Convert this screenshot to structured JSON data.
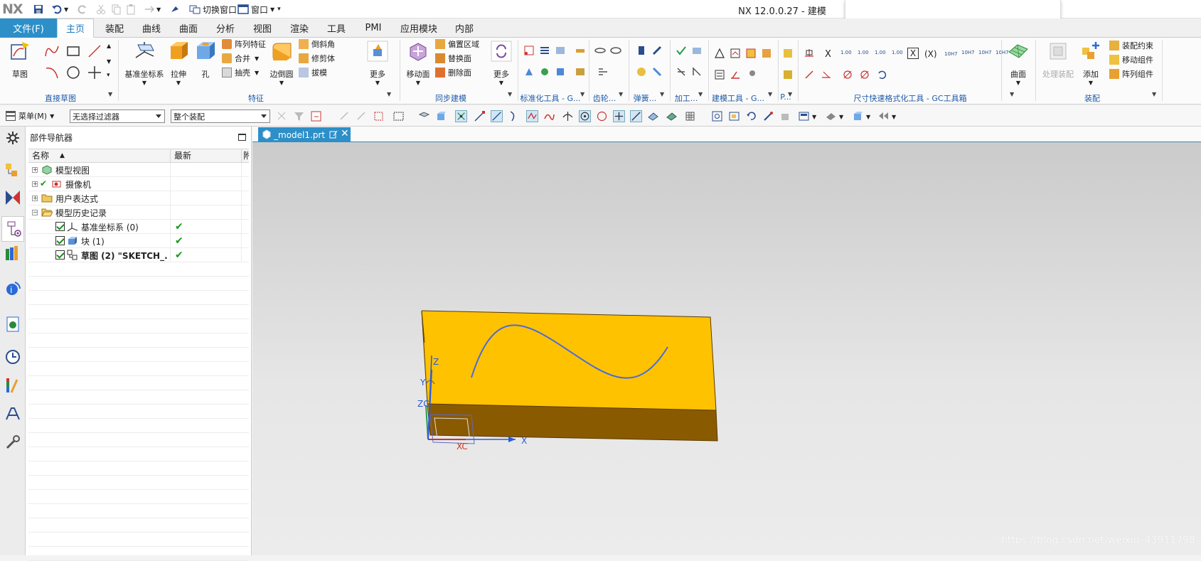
{
  "app": {
    "logo": "NX",
    "title": "NX 12.0.0.27 - 建模"
  },
  "quick_access": {
    "switch_window": "切换窗口",
    "window": "窗口"
  },
  "tabs": {
    "file": "文件(F)",
    "items": [
      "主页",
      "装配",
      "曲线",
      "曲面",
      "分析",
      "视图",
      "渲染",
      "工具",
      "PMI",
      "应用模块",
      "内部"
    ],
    "active": "主页"
  },
  "ribbon": {
    "direct_sketch": {
      "sketch": "草图",
      "label": "直接草图"
    },
    "feature": {
      "datum_csys": "基准坐标系",
      "extrude": "拉伸",
      "hole": "孔",
      "pattern_feature": "阵列特征",
      "unite": "合并",
      "shell": "抽壳",
      "edge_blend": "边倒圆",
      "chamfer": "倒斜角",
      "trim_body": "修剪体",
      "draft": "拔模",
      "more": "更多",
      "label": "特征"
    },
    "sync": {
      "move_face": "移动面",
      "offset_region": "偏置区域",
      "replace_face": "替换面",
      "delete_face": "删除面",
      "more": "更多",
      "label": "同步建模"
    },
    "std_tools": {
      "label": "标准化工具 - G..."
    },
    "gear": {
      "label": "齿轮..."
    },
    "spring": {
      "label": "弹簧..."
    },
    "machining": {
      "label": "加工..."
    },
    "modeling_tools": {
      "label": "建模工具 - G..."
    },
    "p_group": {
      "label": "P..."
    },
    "dim_tools": {
      "label": "尺寸快速格式化工具 - GC工具箱",
      "x": "X",
      "xp": "(X)",
      "v1": "1.00",
      "v2": "1.00",
      "v3": "1.00",
      "v4": "1.00",
      "h1": "10H7",
      "h2": "10H7",
      "h3": "10H7",
      "h4": "10H7"
    },
    "surface": {
      "surface": "曲面",
      "process_assembly": "处理装配",
      "add": "添加"
    },
    "assembly": {
      "constraint": "装配约束",
      "move_component": "移动组件",
      "pattern_component": "阵列组件",
      "label": "装配"
    }
  },
  "toolbar2": {
    "menu": "菜单(M)",
    "filter": "无选择过滤器",
    "scope": "整个装配"
  },
  "navigator": {
    "title": "部件导航器",
    "columns": {
      "name": "名称",
      "latest": "最新",
      "extra": "附"
    },
    "rows": [
      {
        "name": "模型视图",
        "latest": ""
      },
      {
        "name": "摄像机",
        "latest": ""
      },
      {
        "name": "用户表达式",
        "latest": ""
      },
      {
        "name": "模型历史记录",
        "latest": ""
      },
      {
        "name": "基准坐标系 (0)",
        "latest": "✔"
      },
      {
        "name": "块 (1)",
        "latest": "✔"
      },
      {
        "name": "草图 (2) \"SKETCH_...",
        "latest": "✔"
      }
    ]
  },
  "graphics": {
    "tab": "_model1.prt",
    "axes": {
      "z": "Z",
      "x": "X",
      "y": "Y",
      "zc": "ZC",
      "xc": "XC"
    }
  },
  "watermark": "https://blog.csdn.net/weixin_43911798",
  "colors": {
    "file_tab": "#2c8fc8",
    "block_top": "#ffc200",
    "block_front": "#8a5a00",
    "block_side": "#f2b600",
    "sketch": "#4a6adf"
  }
}
